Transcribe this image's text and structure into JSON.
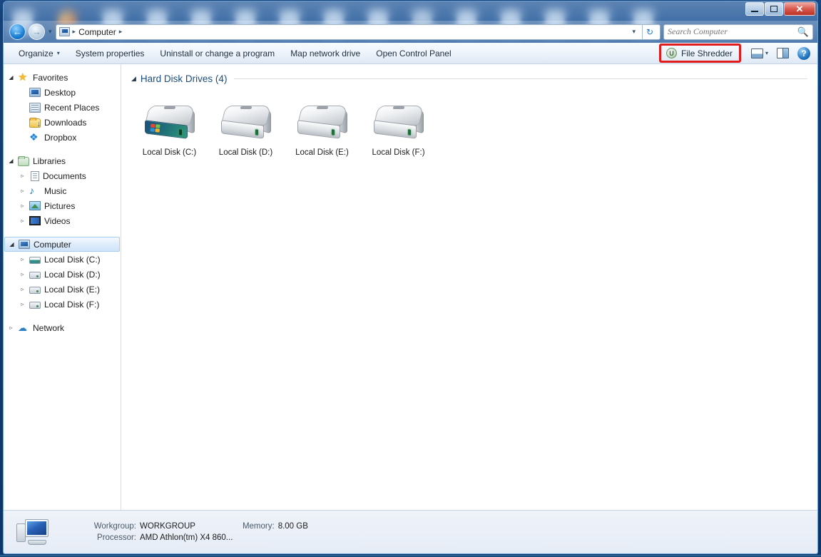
{
  "window": {
    "controls": {
      "minimize": "—",
      "maximize": "□",
      "close": "✕"
    }
  },
  "address_bar": {
    "back_glyph": "←",
    "forward_glyph": "→",
    "history_caret": "▾",
    "breadcrumb_icon": "computer-icon",
    "breadcrumb": "Computer",
    "separator": "▸",
    "dropdown_caret": "▾",
    "refresh_glyph": "↻"
  },
  "search": {
    "placeholder": "Search Computer",
    "value": "",
    "icon": "magnifier-icon"
  },
  "toolbar": {
    "organize": "Organize",
    "organize_caret": "▾",
    "system_properties": "System properties",
    "uninstall": "Uninstall or change a program",
    "map_network_drive": "Map network drive",
    "open_control_panel": "Open Control Panel",
    "file_shredder": "File Shredder",
    "file_shredder_highlight_color": "#e01b1b",
    "view_caret": "▾",
    "help": "?"
  },
  "sidebar": {
    "groups": [
      {
        "name": "Favorites",
        "expanded_glyph": "◢",
        "icon": "star-icon",
        "items": [
          {
            "label": "Desktop",
            "icon": "desktop-icon"
          },
          {
            "label": "Recent Places",
            "icon": "recent-places-icon"
          },
          {
            "label": "Downloads",
            "icon": "downloads-folder-icon"
          },
          {
            "label": "Dropbox",
            "icon": "dropbox-icon"
          }
        ]
      },
      {
        "name": "Libraries",
        "expanded_glyph": "◢",
        "icon": "libraries-icon",
        "items": [
          {
            "label": "Documents",
            "icon": "documents-icon",
            "twisty": "▹"
          },
          {
            "label": "Music",
            "icon": "music-icon",
            "twisty": "▹"
          },
          {
            "label": "Pictures",
            "icon": "pictures-icon",
            "twisty": "▹"
          },
          {
            "label": "Videos",
            "icon": "videos-icon",
            "twisty": "▹"
          }
        ]
      },
      {
        "name": "Computer",
        "expanded_glyph": "◢",
        "icon": "computer-icon",
        "selected": true,
        "items": [
          {
            "label": "Local Disk (C:)",
            "icon": "system-drive-icon",
            "twisty": "▹"
          },
          {
            "label": "Local Disk (D:)",
            "icon": "drive-icon",
            "twisty": "▹"
          },
          {
            "label": "Local Disk (E:)",
            "icon": "drive-icon",
            "twisty": "▹"
          },
          {
            "label": "Local Disk (F:)",
            "icon": "drive-icon",
            "twisty": "▹"
          }
        ]
      },
      {
        "name": "Network",
        "collapsed_glyph": "▹",
        "icon": "network-icon",
        "items": []
      }
    ]
  },
  "content": {
    "group_title": "Hard Disk Drives (4)",
    "group_triangle": "◢",
    "drives": [
      {
        "label": "Local Disk (C:)",
        "system": true
      },
      {
        "label": "Local Disk (D:)",
        "system": false
      },
      {
        "label": "Local Disk (E:)",
        "system": false
      },
      {
        "label": "Local Disk (F:)",
        "system": false
      }
    ]
  },
  "status_bar": {
    "item_icon": "computer-icon",
    "workgroup_label": "Workgroup:",
    "workgroup_value": "WORKGROUP",
    "memory_label": "Memory:",
    "memory_value": "8.00 GB",
    "processor_label": "Processor:",
    "processor_value": "AMD Athlon(tm) X4 860..."
  }
}
